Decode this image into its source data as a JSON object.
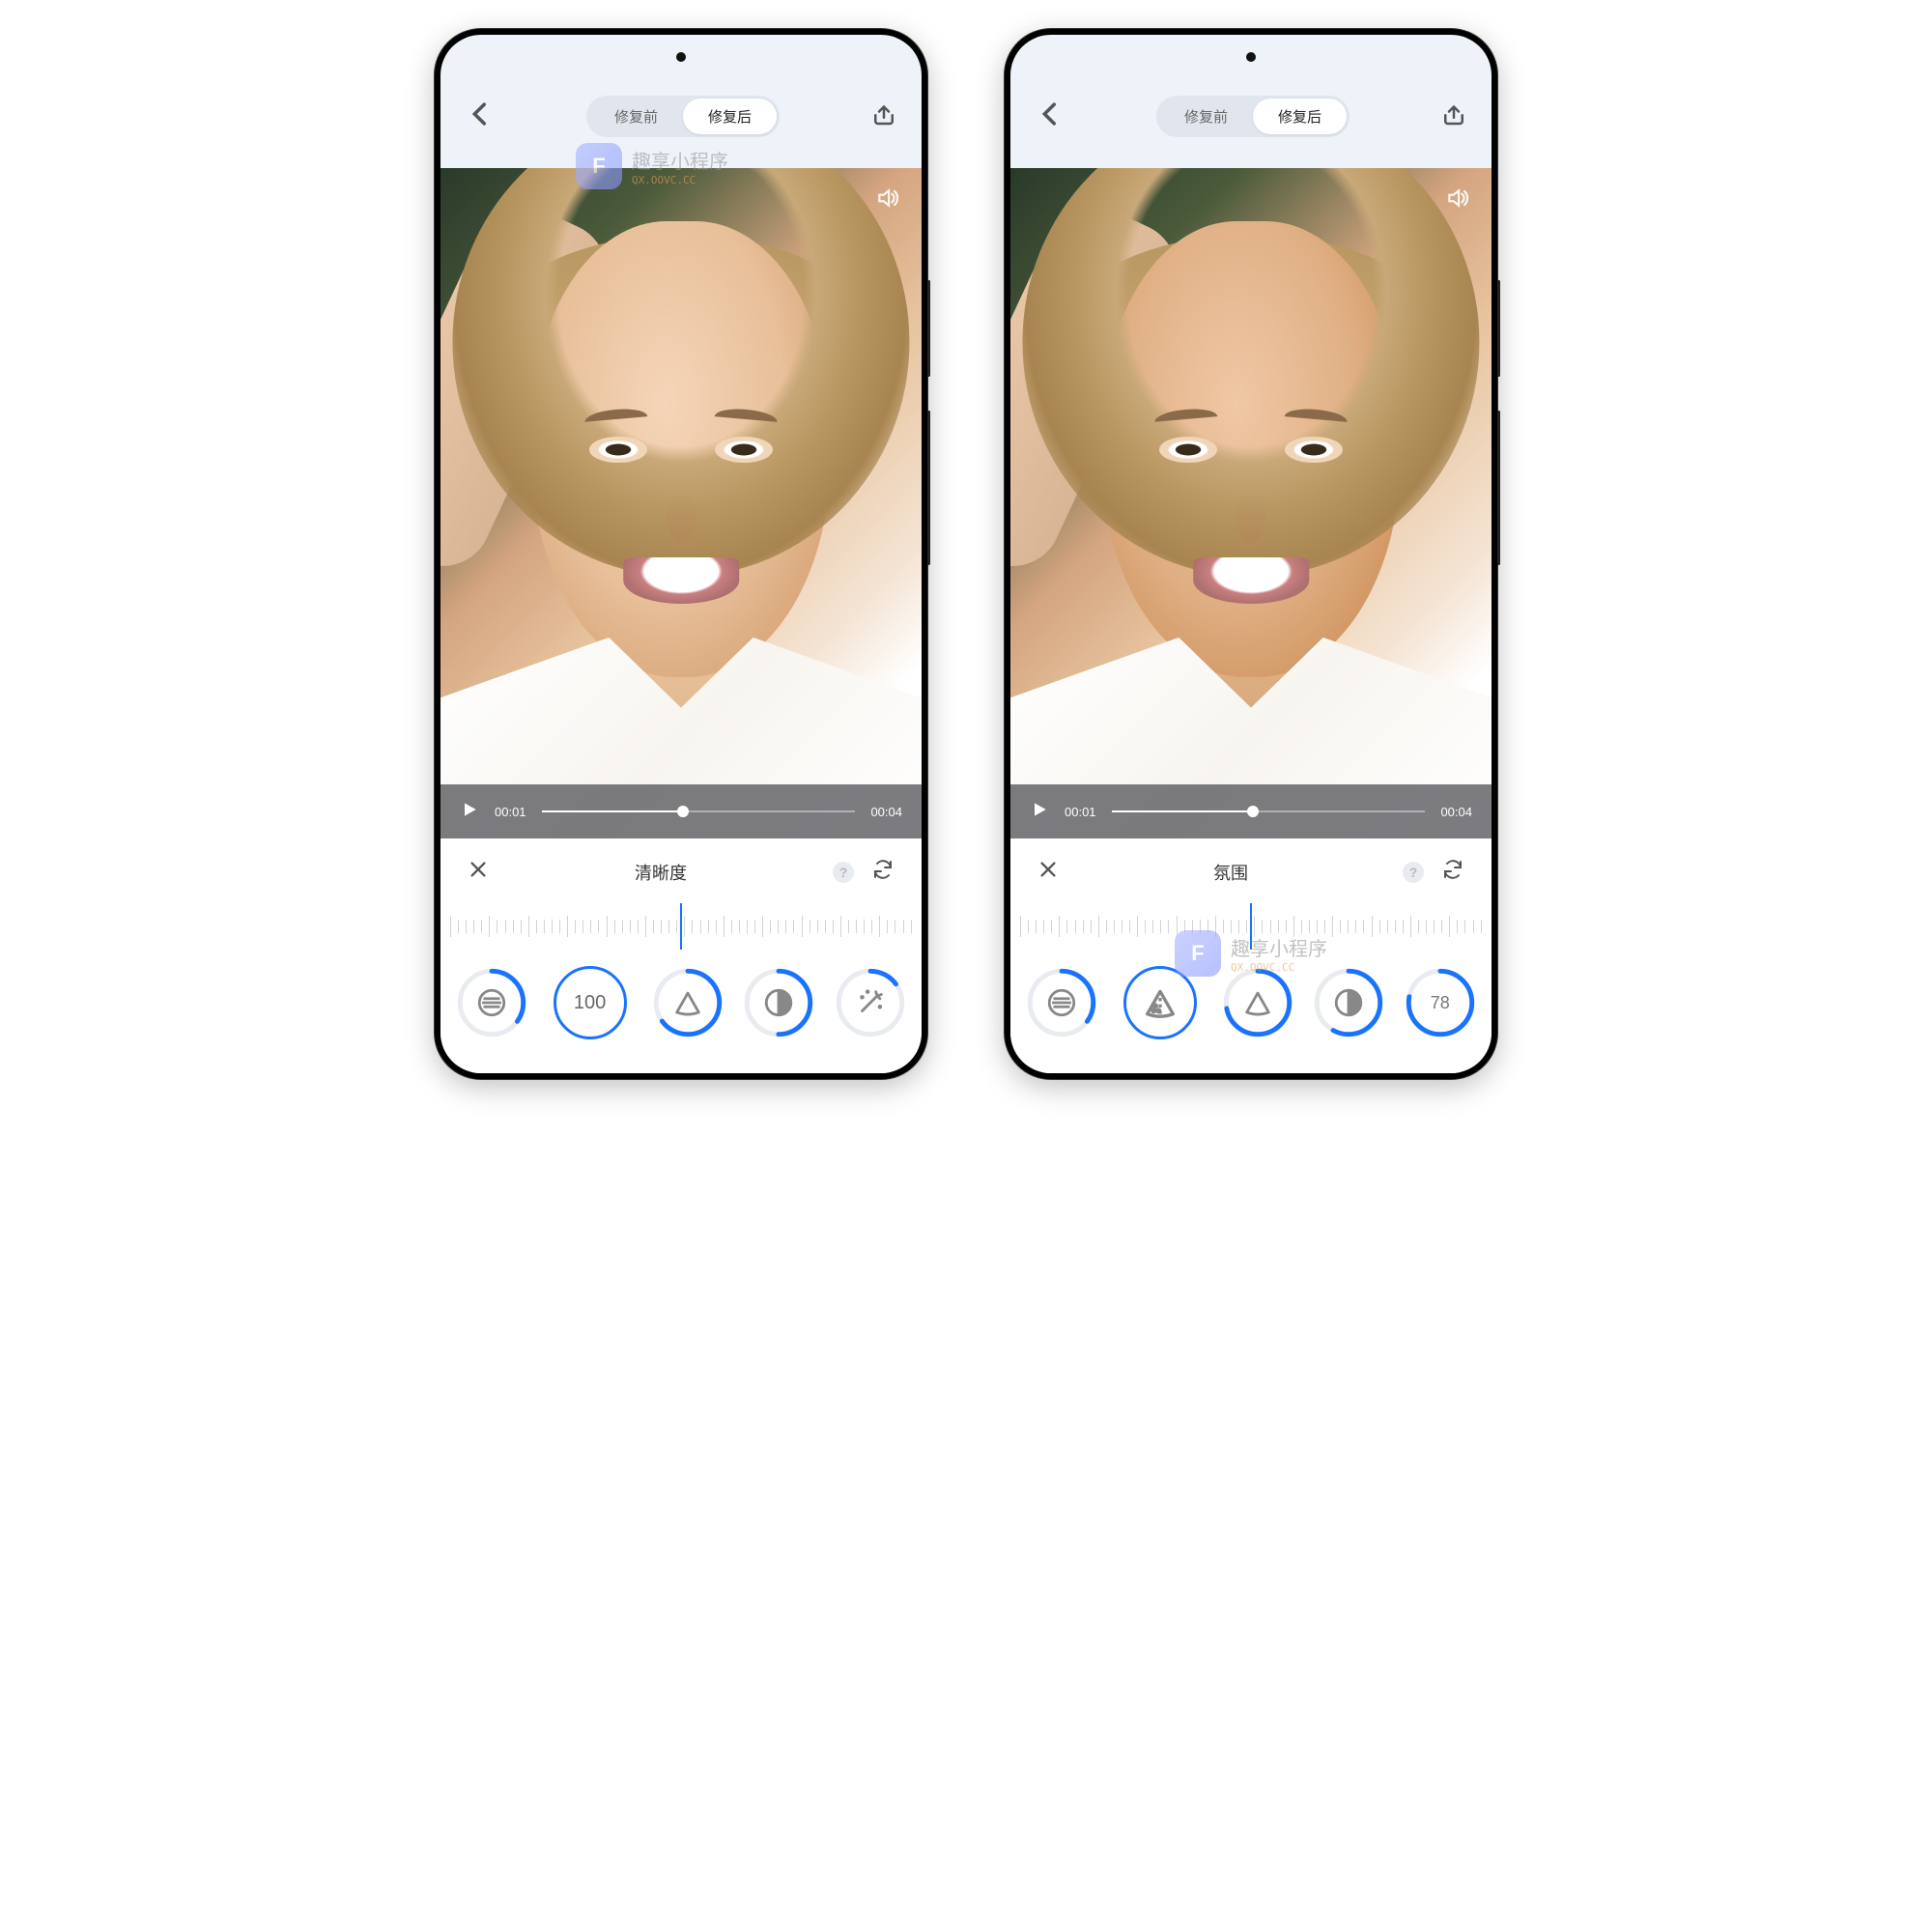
{
  "tabs": {
    "before": "修复前",
    "after": "修复后"
  },
  "watermark": {
    "badge": "F",
    "title": "趣享小程序",
    "sub": "QX.OOVC.CC"
  },
  "playbar": {
    "current": "00:01",
    "total": "00:04"
  },
  "screens": [
    {
      "control_name": "清晰度",
      "dials": [
        {
          "type": "icon",
          "icon": "lines",
          "progress": 0.35,
          "big": false
        },
        {
          "type": "text",
          "text": "100",
          "progress": 1.0,
          "big": true
        },
        {
          "type": "icon",
          "icon": "triangle",
          "progress": 0.65,
          "big": false
        },
        {
          "type": "icon",
          "icon": "contrast",
          "progress": 0.5,
          "big": false
        },
        {
          "type": "icon",
          "icon": "wand",
          "progress": 0.15,
          "big": false
        }
      ]
    },
    {
      "control_name": "氛围",
      "dials": [
        {
          "type": "icon",
          "icon": "lines",
          "progress": 0.35,
          "big": false
        },
        {
          "type": "icon",
          "icon": "slice",
          "progress": 0.82,
          "big": true
        },
        {
          "type": "icon",
          "icon": "triangle",
          "progress": 0.72,
          "big": false
        },
        {
          "type": "icon",
          "icon": "contrast",
          "progress": 0.58,
          "big": false
        },
        {
          "type": "text",
          "text": "78",
          "progress": 0.78,
          "big": false
        }
      ]
    }
  ]
}
